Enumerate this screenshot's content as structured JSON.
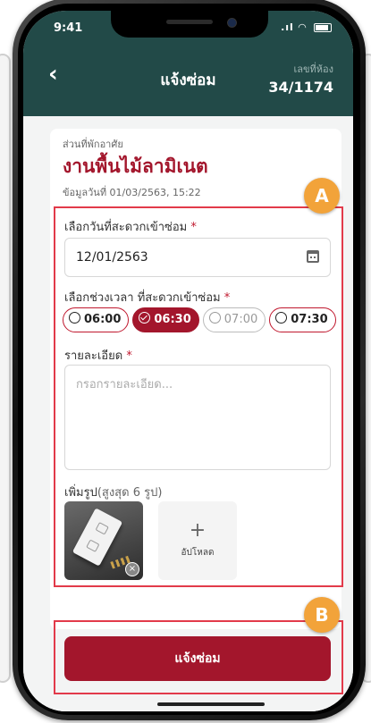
{
  "status_bar": {
    "time": "9:41",
    "signal": ".ıl"
  },
  "header": {
    "back_icon": "chevron-left-icon",
    "title": "แจ้งซ่อม",
    "room_label": "เลขที่ห้อง",
    "room_number": "34/1174"
  },
  "section": {
    "label": "ส่วนที่พักอาศัย",
    "title": "งานพื้นไม้ลามิเนต",
    "date": "ข้อมูลวันที่ 01/03/2563, 15:22"
  },
  "markers": {
    "a": "A",
    "b": "B"
  },
  "form": {
    "date_label": "เลือกวันที่สะดวกเข้าซ่อม",
    "date_value": "12/01/2563",
    "time_label": "เลือกช่วงเวลา ที่สะดวกเข้าซ่อม",
    "time_slots": [
      {
        "label": "06:00",
        "state": "available"
      },
      {
        "label": "06:30",
        "state": "selected"
      },
      {
        "label": "07:00",
        "state": "disabled"
      },
      {
        "label": "07:30",
        "state": "available"
      }
    ],
    "detail_label": "รายละเอียด",
    "detail_placeholder": "กรอกรายละเอียด...",
    "required_mark": "*",
    "photo_label": "เพิ่มรูป",
    "photo_sub": "(สูงสุด 6 รูป)",
    "upload_plus": "+",
    "upload_label": "อัปโหลด",
    "remove_icon": "×"
  },
  "submit_label": "แจ้งซ่อม",
  "colors": {
    "header_bg": "#224a48",
    "accent": "#a3162c",
    "annotation": "#e23a4a",
    "marker": "#f2a33a"
  }
}
